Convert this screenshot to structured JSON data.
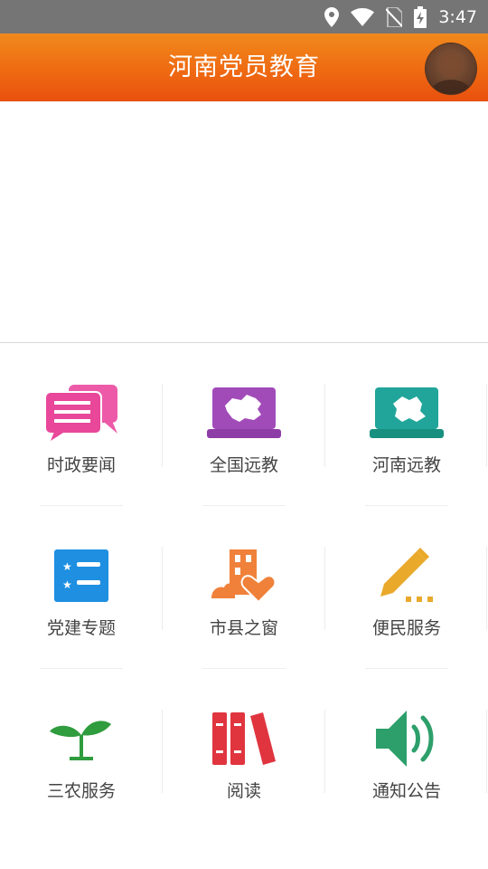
{
  "status_bar": {
    "time": "3:47",
    "icons": [
      "location-icon",
      "wifi-icon",
      "no-sim-icon",
      "battery-charging-icon"
    ]
  },
  "app_bar": {
    "title": "河南党员教育",
    "avatar": "avatar-icon"
  },
  "menu": [
    {
      "label": "时政要闻",
      "icon": "news-chat-icon",
      "color": "#e8479a"
    },
    {
      "label": "全国远教",
      "icon": "laptop-china-map-icon",
      "color": "#a14bb8"
    },
    {
      "label": "河南远教",
      "icon": "laptop-henan-map-icon",
      "color": "#21a59a"
    },
    {
      "label": "党建专题",
      "icon": "topic-list-icon",
      "color": "#1e8fe1"
    },
    {
      "label": "市县之窗",
      "icon": "city-heart-icon",
      "color": "#f0813a"
    },
    {
      "label": "便民服务",
      "icon": "pencil-icon",
      "color": "#e9a92b"
    },
    {
      "label": "三农服务",
      "icon": "sprout-icon",
      "color": "#2f9c3e"
    },
    {
      "label": "阅读",
      "icon": "books-icon",
      "color": "#e0353f"
    },
    {
      "label": "通知公告",
      "icon": "speaker-icon",
      "color": "#2d9f6b"
    }
  ]
}
